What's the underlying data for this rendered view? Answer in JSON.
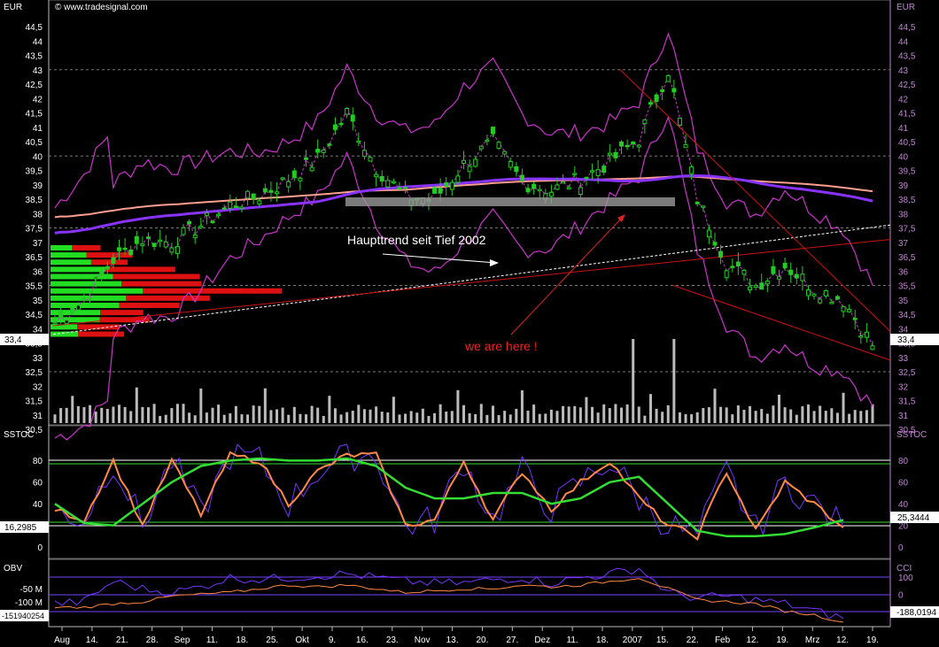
{
  "header": {
    "copyright": "© www.tradesignal.com",
    "currency_left": "EUR",
    "currency_right": "EUR"
  },
  "annotations": {
    "trend_text": "Haupttrend seit Tief 2002",
    "here_text": "we are here !"
  },
  "price_axis": {
    "ticks": [
      "44,5",
      "44",
      "43,5",
      "43",
      "42,5",
      "42",
      "41,5",
      "41",
      "40,5",
      "40",
      "39,5",
      "39",
      "38,5",
      "38",
      "37,5",
      "37",
      "36,5",
      "36",
      "35,5",
      "35",
      "34,5",
      "34",
      "33,5",
      "33",
      "32,5",
      "32",
      "31,5",
      "31",
      "30,5"
    ],
    "last_left": "33,4",
    "last_right": "33,4"
  },
  "sstoc_axis": {
    "title_left": "SSTOC",
    "title_right": "SSTOC",
    "ticks": [
      "80",
      "60",
      "40",
      "20",
      "0"
    ],
    "value_left": "16,2985",
    "value_right": "25,3444"
  },
  "obv_axis": {
    "title_left": "OBV",
    "title_right": "CCI",
    "ticks_left": [
      "-50 M",
      "-100 M"
    ],
    "ticks_right": [
      "100",
      "0",
      "-100"
    ],
    "value_left": "-151940254",
    "value_right": "-188,0194"
  },
  "x_axis": {
    "labels": [
      "Aug",
      "14.",
      "21.",
      "28.",
      "Sep",
      "11.",
      "18.",
      "25.",
      "Okt",
      "9.",
      "16.",
      "23.",
      "Nov",
      "13.",
      "20.",
      "27.",
      "Dez",
      "11.",
      "18.",
      "2007",
      "15.",
      "22.",
      "Feb",
      "12.",
      "19.",
      "Mrz",
      "12.",
      "19."
    ]
  },
  "colors": {
    "candle": "#22cc22",
    "bollinger": "#cc33cc",
    "ma_purple": "#8833ff",
    "ma_salmon": "#ff9f8f",
    "trendline": "#cc1111",
    "volume": "#bbbbbb",
    "profile_green": "#22dd22",
    "profile_red": "#dd1111",
    "osc_orange": "#ff8844",
    "osc_green": "#33dd33",
    "osc_purple": "#7733ff",
    "grid": "#888888",
    "axis_right": "#c084d0"
  },
  "chart_data": [
    {
      "type": "candlestick",
      "title": "",
      "ylabel": "EUR",
      "ylim": [
        30.5,
        44.5
      ],
      "x": [
        "Aug",
        "14.",
        "21.",
        "28.",
        "Sep",
        "11.",
        "18.",
        "25.",
        "Okt",
        "9.",
        "16.",
        "23.",
        "Nov",
        "13.",
        "20.",
        "27.",
        "Dez",
        "11.",
        "18.",
        "2007",
        "15.",
        "22.",
        "Feb",
        "12.",
        "19.",
        "Mrz",
        "12.",
        "19."
      ],
      "series": [
        {
          "name": "",
          "values": [
            34.2,
            35.0,
            36.4,
            37.1,
            37.0,
            37.6,
            38.3,
            38.6,
            39.2,
            39.9,
            41.5,
            39.6,
            38.6,
            38.5,
            39.7,
            40.5,
            39.1,
            38.8,
            39.2,
            39.8,
            40.6,
            43.0,
            38.5,
            36.3,
            35.5,
            36.2,
            35.4,
            35.0,
            33.4
          ]
        }
      ],
      "last_value": 33.4
    },
    {
      "type": "line",
      "title": "SSTOC",
      "ylim": [
        -10,
        95
      ],
      "x": [
        "Aug",
        "14.",
        "21.",
        "28.",
        "Sep",
        "11.",
        "18.",
        "25.",
        "Okt",
        "9.",
        "16.",
        "23.",
        "Nov",
        "13.",
        "20.",
        "27.",
        "Dez",
        "11.",
        "18.",
        "2007",
        "15.",
        "22.",
        "Feb",
        "12.",
        "19.",
        "Mrz",
        "12.",
        "19."
      ],
      "series": [
        {
          "name": "",
          "values": [
            35,
            25,
            80,
            20,
            80,
            30,
            85,
            80,
            40,
            70,
            85,
            85,
            20,
            25,
            80,
            25,
            70,
            35,
            60,
            80,
            45,
            20,
            10,
            70,
            15,
            60,
            40,
            18
          ]
        },
        {
          "name": "",
          "values": [
            40,
            22,
            20,
            40,
            60,
            75,
            80,
            82,
            80,
            80,
            82,
            75,
            55,
            45,
            45,
            50,
            50,
            40,
            45,
            60,
            65,
            40,
            15,
            10,
            10,
            12,
            18,
            25
          ]
        }
      ],
      "last_values": [
        16.2985,
        25.3444
      ]
    },
    {
      "type": "line",
      "title": "OBV",
      "ylim": [
        -150,
        10
      ],
      "x": [
        "Aug",
        "14.",
        "21.",
        "28.",
        "Sep",
        "11.",
        "18.",
        "25.",
        "Okt",
        "9.",
        "16.",
        "23.",
        "Nov",
        "13.",
        "20.",
        "27.",
        "Dez",
        "11.",
        "18.",
        "2007",
        "15.",
        "22.",
        "Feb",
        "12.",
        "19.",
        "Mrz",
        "12.",
        "19."
      ],
      "series": [
        {
          "name": "",
          "values": [
            -100,
            -95,
            -40,
            -60,
            -70,
            -55,
            -30,
            -35,
            -30,
            -25,
            -20,
            -30,
            -40,
            -45,
            -45,
            -35,
            -30,
            -45,
            -30,
            -20,
            -5,
            -70,
            -85,
            -80,
            -90,
            -100,
            -120,
            -140
          ]
        },
        {
          "name": "",
          "values": [
            -110,
            -110,
            -100,
            -95,
            -80,
            -75,
            -70,
            -60,
            -50,
            -55,
            -50,
            -60,
            -70,
            -65,
            -60,
            -60,
            -50,
            -55,
            -50,
            -40,
            -30,
            -60,
            -90,
            -95,
            -100,
            -120,
            -130,
            -150
          ]
        }
      ],
      "last_values": [
        -151940254,
        -188.0194
      ]
    }
  ]
}
